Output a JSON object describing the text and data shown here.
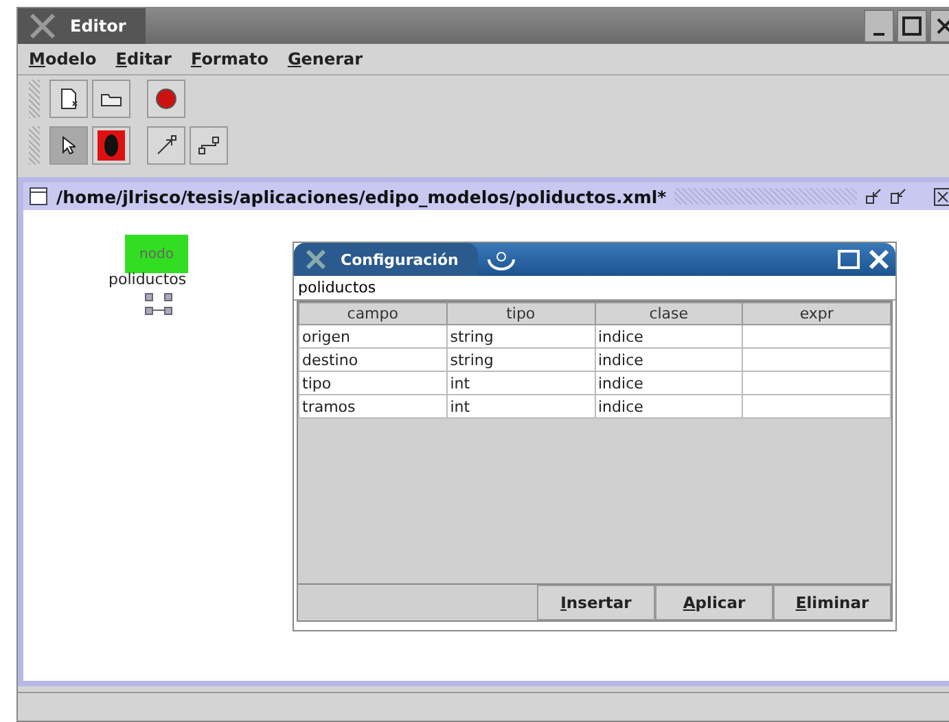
{
  "window": {
    "title": "Editor"
  },
  "menu": [
    "Modelo",
    "Editar",
    "Formato",
    "Generar"
  ],
  "toolbar_1": [
    {
      "kind": "new",
      "selected": false
    },
    {
      "kind": "open",
      "selected": false
    },
    {
      "kind": "stop",
      "selected": false
    }
  ],
  "toolbar_2": [
    {
      "kind": "pointer",
      "selected": true
    },
    {
      "kind": "node",
      "selected": false
    },
    {
      "kind": "arrow",
      "selected": false
    },
    {
      "kind": "link",
      "selected": false
    }
  ],
  "document": {
    "title": "/home/jlrisco/tesis/aplicaciones/edipo_modelos/poliductos.xml*"
  },
  "node": {
    "label": "nodo",
    "name": "poliductos",
    "selected": true
  },
  "dialog": {
    "title": "Configuración",
    "name": "poliductos",
    "columns": [
      "campo",
      "tipo",
      "clase",
      "expr"
    ],
    "rows": [
      [
        "origen",
        "string",
        "indice",
        ""
      ],
      [
        "destino",
        "string",
        "indice",
        ""
      ],
      [
        "tipo",
        "int",
        "indice",
        ""
      ],
      [
        "tramos",
        "int",
        "indice",
        ""
      ]
    ],
    "buttons": [
      "Insertar",
      "Aplicar",
      "Eliminar"
    ]
  }
}
